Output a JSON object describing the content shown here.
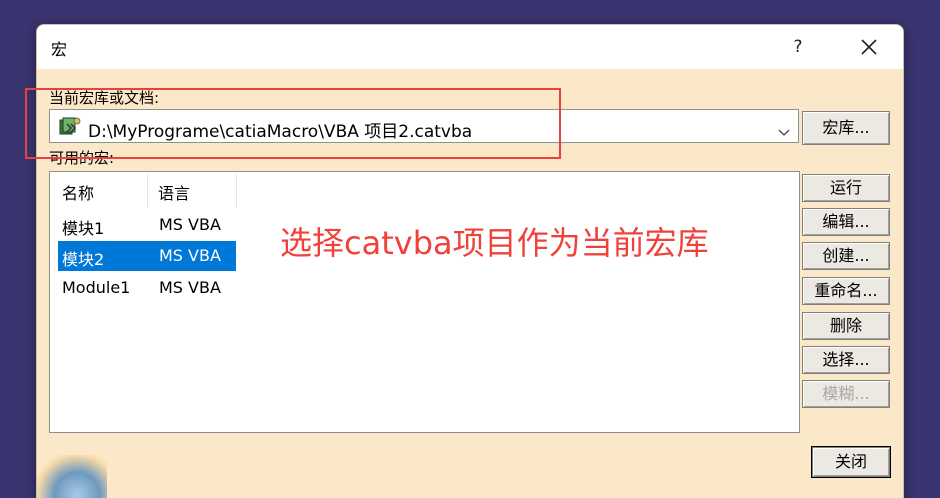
{
  "window": {
    "title": "宏",
    "help_label": "?",
    "close_label": "close"
  },
  "library": {
    "label": "当前宏库或文档:",
    "current_value": "D:\\MyPrograme\\catiaMacro\\VBA 项目2.catvba",
    "library_button": "宏库..."
  },
  "macros": {
    "label": "可用的宏:",
    "columns": [
      "名称",
      "语言"
    ],
    "rows": [
      {
        "name": "模块1",
        "language": "MS VBA",
        "selected": false
      },
      {
        "name": "模块2",
        "language": "MS VBA",
        "selected": true
      },
      {
        "name": "Module1",
        "language": "MS VBA",
        "selected": false
      }
    ]
  },
  "actions": {
    "run": "运行",
    "edit": "编辑...",
    "create": "创建...",
    "rename": "重命名...",
    "delete": "删除",
    "select": "选择...",
    "fuzzy": "模糊..."
  },
  "footer": {
    "close_button": "关闭"
  },
  "annotation": {
    "text": "选择catvba项目作为当前宏库",
    "color": "#e8413f"
  },
  "colors": {
    "dialog_bg": "#fbe8c9",
    "selection": "#0078d7",
    "desktop": "#3a3570"
  }
}
